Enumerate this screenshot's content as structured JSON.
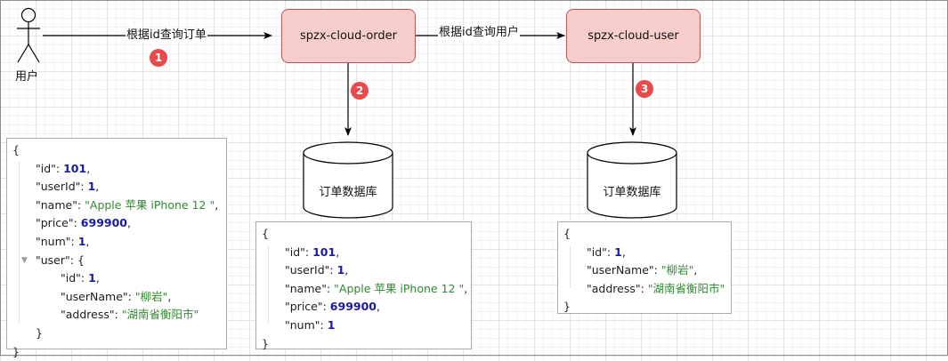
{
  "actor": {
    "label": "用户"
  },
  "edges": {
    "query_order": "根据id查询订单",
    "query_user": "根据id查询用户"
  },
  "badges": [
    "1",
    "2",
    "3"
  ],
  "services": {
    "order": "spzx-cloud-order",
    "user": "spzx-cloud-user"
  },
  "databases": {
    "order_db": "订单数据库",
    "user_db": "订单数据库"
  },
  "json_full": {
    "open": "{",
    "id_key": "\"id\"",
    "id_val": "101",
    "userId_key": "\"userId\"",
    "userId_val": "1",
    "name_key": "\"name\"",
    "name_val": "\"Apple 苹果 iPhone 12 \"",
    "price_key": "\"price\"",
    "price_val": "699900",
    "num_key": "\"num\"",
    "num_val": "1",
    "user_key": "\"user\"",
    "u_id_key": "\"id\"",
    "u_id_val": "1",
    "u_name_key": "\"userName\"",
    "u_name_val": "\"柳岩\"",
    "u_addr_key": "\"address\"",
    "u_addr_val": "\"湖南省衡阳市\"",
    "inner_close": "}",
    "close": "}"
  },
  "json_order": {
    "open": "{",
    "id_key": "\"id\"",
    "id_val": "101",
    "userId_key": "\"userId\"",
    "userId_val": "1",
    "name_key": "\"name\"",
    "name_val": "\"Apple 苹果 iPhone 12 \"",
    "price_key": "\"price\"",
    "price_val": "699900",
    "num_key": "\"num\"",
    "num_val": "1",
    "close": "}"
  },
  "json_user": {
    "open": "{",
    "id_key": "\"id\"",
    "id_val": "1",
    "name_key": "\"userName\"",
    "name_val": "\"柳岩\"",
    "addr_key": "\"address\"",
    "addr_val": "\"湖南省衡阳市\"",
    "close": "}"
  },
  "colors": {
    "service_fill": "#f8cecc",
    "service_stroke": "#b85450",
    "badge": "#ea4a4a",
    "json_number": "#1a1aa6",
    "json_string": "#2f8a2f"
  }
}
